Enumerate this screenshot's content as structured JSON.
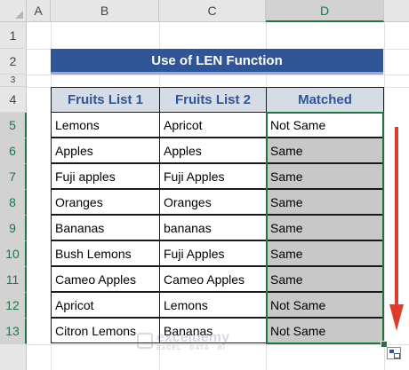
{
  "columns": [
    "A",
    "B",
    "C",
    "D"
  ],
  "rows": [
    "1",
    "2",
    "3",
    "4",
    "5",
    "6",
    "7",
    "8",
    "9",
    "10",
    "11",
    "12",
    "13"
  ],
  "title": "Use of LEN Function",
  "headers": [
    "Fruits List 1",
    "Fruits List 2",
    "Matched"
  ],
  "table": [
    [
      "Lemons",
      "Apricot",
      "Not Same"
    ],
    [
      "Apples",
      "Apples",
      "Same"
    ],
    [
      "Fuji apples",
      "Fuji Apples",
      "Same"
    ],
    [
      "Oranges",
      "Oranges",
      "Same"
    ],
    [
      "Bananas",
      "bananas",
      "Same"
    ],
    [
      "Bush Lemons",
      "Fuji Apples",
      "Same"
    ],
    [
      "Cameo Apples",
      "Cameo Apples",
      "Same"
    ],
    [
      "Apricot",
      "Lemons",
      "Not Same"
    ],
    [
      "Citron Lemons",
      "Bananas",
      "Not Same"
    ]
  ],
  "watermark": "exceldemy",
  "watermark_sub": "EXCEL · DATA · BI",
  "colors": {
    "title_bg": "#2f5597",
    "header_bg": "#d6dce5",
    "selection": "#217346",
    "arrow": "#e03a2a"
  }
}
